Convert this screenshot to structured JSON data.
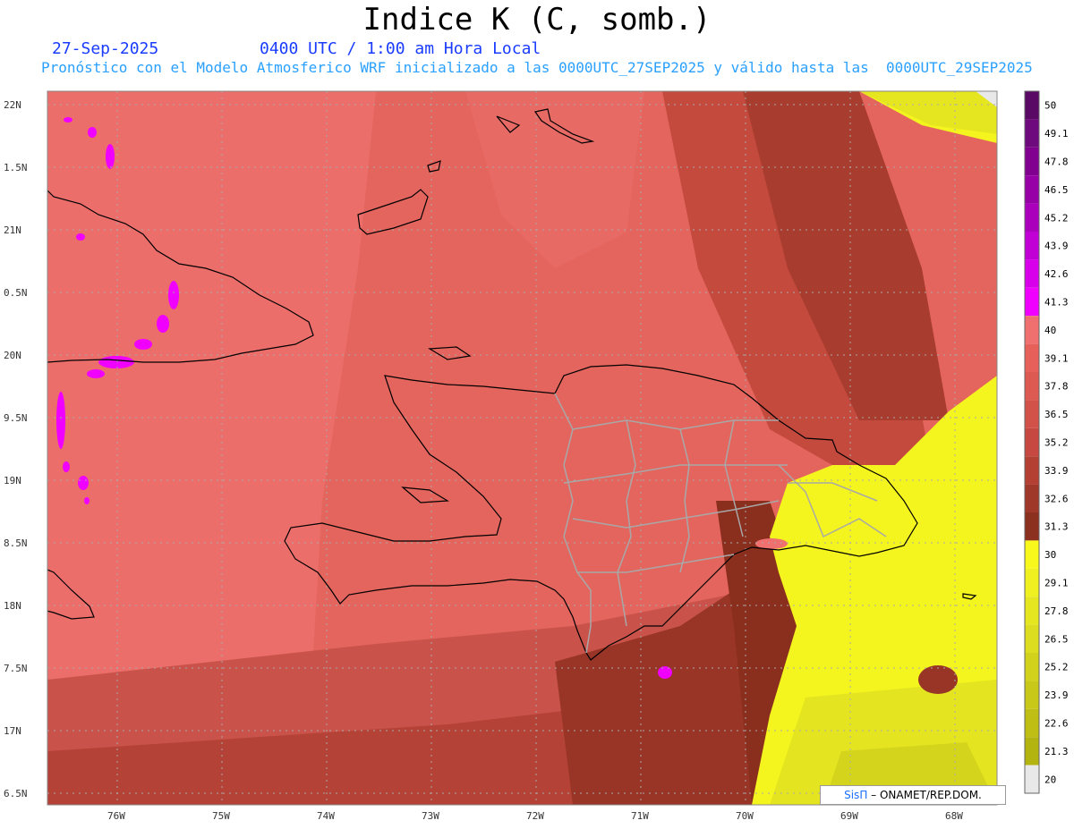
{
  "header": {
    "title": "Indice K (C, somb.)",
    "date": "27-Sep-2025",
    "time": "0400 UTC / 1:00 am Hora Local",
    "subtitle": "Pronóstico con el Modelo Atmosferico WRF inicializado a las 0000UTC_27SEP2025 y válido hasta las  0000UTC_29SEP2025"
  },
  "axes": {
    "latitudes": [
      "22N",
      "1.5N",
      "21N",
      "0.5N",
      "20N",
      "9.5N",
      "19N",
      "8.5N",
      "18N",
      "7.5N",
      "17N",
      "6.5N"
    ],
    "longitudes": [
      "76W",
      "75W",
      "74W",
      "73W",
      "72W",
      "71W",
      "70W",
      "69W",
      "68W"
    ]
  },
  "colorbar": {
    "labels": [
      "50",
      "49.1",
      "47.8",
      "46.5",
      "45.2",
      "43.9",
      "42.6",
      "41.3",
      "40",
      "39.1",
      "37.8",
      "36.5",
      "35.2",
      "33.9",
      "32.6",
      "31.3",
      "30",
      "29.1",
      "27.8",
      "26.5",
      "25.2",
      "23.9",
      "22.6",
      "21.3",
      "20"
    ],
    "colors": [
      "#5a0a64",
      "#6e0a7e",
      "#82008f",
      "#9600a6",
      "#aa00bc",
      "#c000d4",
      "#d800ea",
      "#f000ff",
      "#f07070",
      "#e8605a",
      "#dc5a52",
      "#d2524a",
      "#c64840",
      "#b44034",
      "#a0382a",
      "#8c3020",
      "#f8f81c",
      "#f0f020",
      "#e6e620",
      "#dcdc20",
      "#d2d21c",
      "#c8c818",
      "#bebe14",
      "#b4b410",
      "#e8e8e8"
    ]
  },
  "credit": {
    "brand": "SisΠ",
    "text": " – ONAMET/REP.DOM."
  }
}
